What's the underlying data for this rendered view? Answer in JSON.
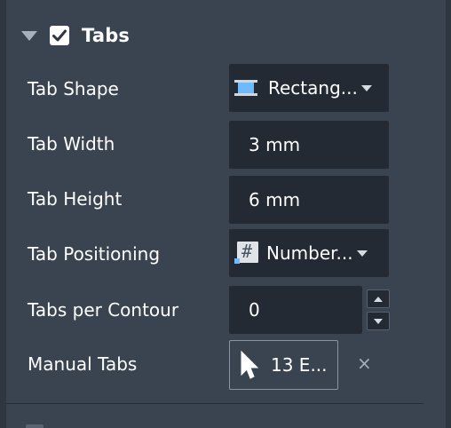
{
  "section": {
    "title": "Tabs",
    "enabled": true
  },
  "rows": {
    "tab_shape": {
      "label": "Tab Shape",
      "value": "Rectang...",
      "icon": "rectangle-tab-icon"
    },
    "tab_width": {
      "label": "Tab Width",
      "value": "3 mm"
    },
    "tab_height": {
      "label": "Tab Height",
      "value": "6 mm"
    },
    "tab_positioning": {
      "label": "Tab Positioning",
      "value": "Number...",
      "icon": "hash-icon"
    },
    "tabs_per_contour": {
      "label": "Tabs per Contour",
      "value": "0"
    },
    "manual_tabs": {
      "label": "Manual Tabs",
      "value": "13 E...",
      "icon": "pointer-cursor-icon",
      "clear": "×"
    }
  },
  "colors": {
    "background": "#3a4350",
    "field_background": "#232a33",
    "accent": "#6fb9ff"
  }
}
